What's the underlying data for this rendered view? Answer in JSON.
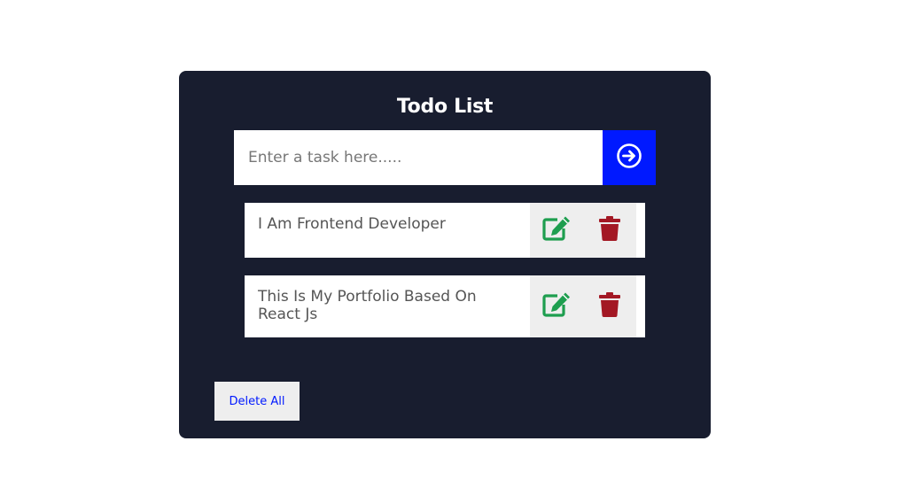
{
  "app": {
    "title": "Todo List"
  },
  "input": {
    "placeholder": "Enter a task here.....",
    "value": "",
    "submit_icon": "arrow-circle-right-icon"
  },
  "todos": [
    {
      "text": "I Am Frontend Developer",
      "edit_icon": "edit-icon",
      "delete_icon": "trash-icon"
    },
    {
      "text": "This Is My Portfolio Based On React Js",
      "edit_icon": "edit-icon",
      "delete_icon": "trash-icon"
    }
  ],
  "footer": {
    "delete_all_label": "Delete All"
  },
  "colors": {
    "card_bg": "#181d2f",
    "accent": "#0019ff",
    "edit": "#1e9e4f",
    "delete": "#a31824",
    "action_bg": "#eeeeee"
  }
}
